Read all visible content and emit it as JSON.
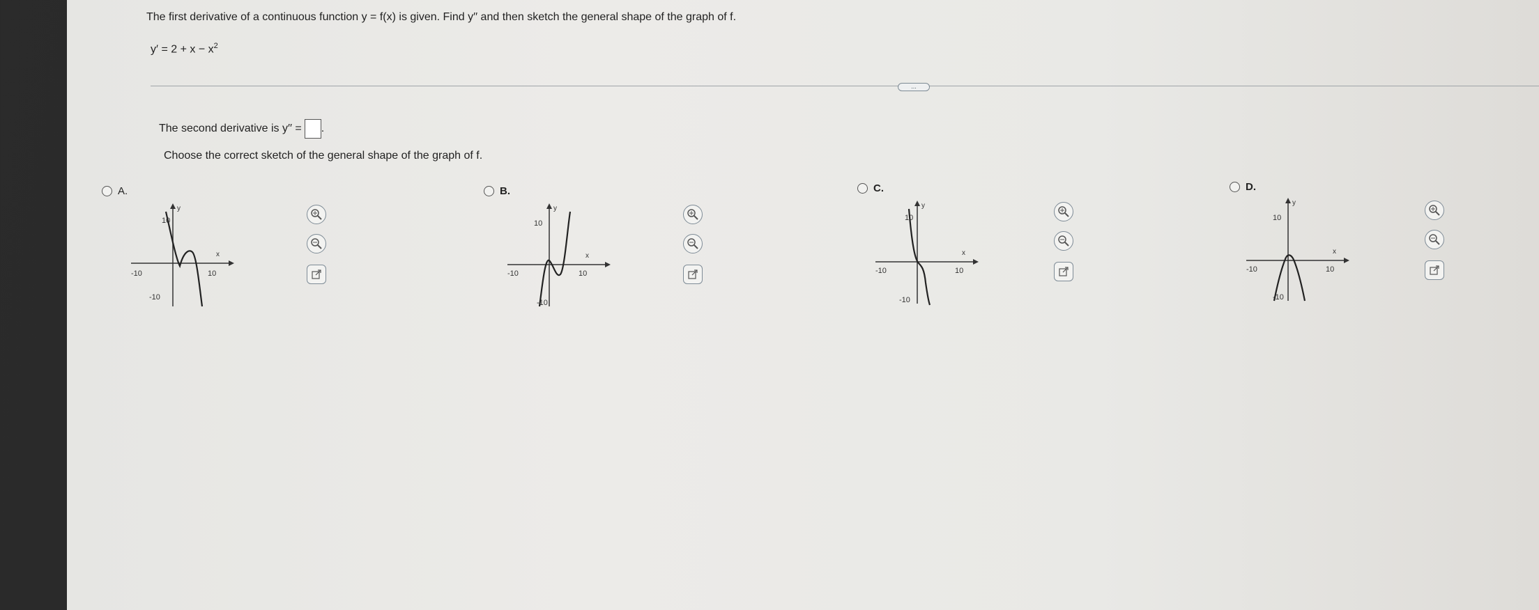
{
  "question": "The first derivative of a continuous function y = f(x) is given. Find y′′ and then sketch the general shape of the graph of f.",
  "given_function": {
    "lhs": "y′ = 2 + x − x",
    "exponent": "2"
  },
  "more_button": "...",
  "second_derivative_prompt": {
    "before": "The second derivative is y′′ =",
    "after": "."
  },
  "choose_prompt": "Choose the correct sketch of the general shape of the graph of f.",
  "options": [
    {
      "label": "A.",
      "axes": {
        "y_top": "10",
        "y_bottom": "-10",
        "x_left": "-10",
        "x_right": "10",
        "x_name": "x",
        "y_name": "y"
      }
    },
    {
      "label": "B.",
      "axes": {
        "y_top": "10",
        "y_bottom": "-10",
        "x_left": "-10",
        "x_right": "10",
        "x_name": "x",
        "y_name": "y"
      }
    },
    {
      "label": "C.",
      "axes": {
        "y_top": "10",
        "y_bottom": "-10",
        "x_left": "-10",
        "x_right": "10",
        "x_name": "x",
        "y_name": "y"
      }
    },
    {
      "label": "D.",
      "axes": {
        "y_top": "10",
        "y_bottom": "-10",
        "x_left": "-10",
        "x_right": "10",
        "x_name": "x",
        "y_name": "y"
      }
    }
  ],
  "tool_icons": [
    "zoom-in-icon",
    "zoom-out-icon",
    "external-link-icon"
  ],
  "colors": {
    "tool_border": "#7e8b96",
    "divider": "#9fa4a8"
  }
}
